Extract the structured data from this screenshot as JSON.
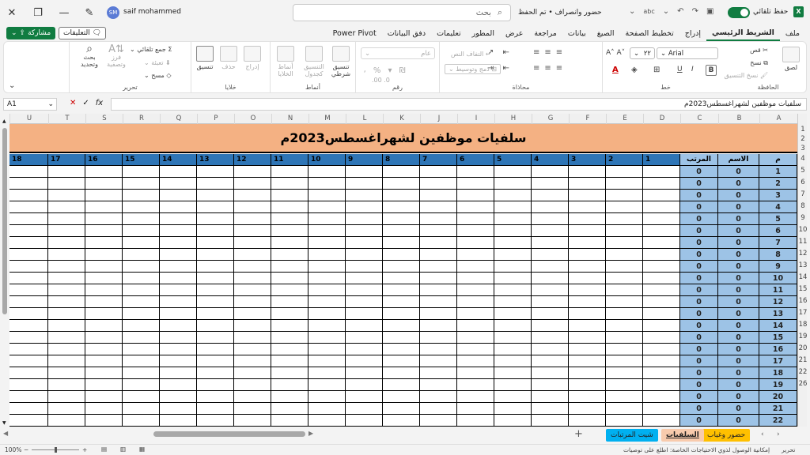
{
  "window": {
    "autosave_label": "حفظ تلقائي",
    "doc_title": "حضور وانصراف • تم الحفظ",
    "search_placeholder": "بحث",
    "user_name": "saif mohammed",
    "user_initials": "SM"
  },
  "tabs": [
    "ملف",
    "الشريط الرئيسي",
    "إدراج",
    "تخطيط الصفحة",
    "الصيغ",
    "بيانات",
    "مراجعة",
    "عرض",
    "المطور",
    "تعليمات",
    "دفق البيانات",
    "Power Pivot"
  ],
  "active_tab": "الشريط الرئيسي",
  "share": {
    "comments_label": "التعليقات",
    "share_label": "مشاركة"
  },
  "ribbon": {
    "clipboard": {
      "label": "الحافظة",
      "paste": "لصق",
      "cut": "قص",
      "copy": "نسخ",
      "format_painter": "نسخ التنسيق"
    },
    "font": {
      "label": "خط",
      "name": "Arial",
      "size": "٢٢",
      "bold": "B",
      "italic": "I",
      "underline": "U"
    },
    "alignment": {
      "label": "محاذاة",
      "wrap": "التفاف النص",
      "merge": "دمج وتوسيط"
    },
    "number": {
      "label": "رقم",
      "format": "عام"
    },
    "styles": {
      "label": "أنماط",
      "conditional": "تنسيق شرطي",
      "table": "التنسيق كجدول",
      "cell_styles": "أنماط الخلايا"
    },
    "cells": {
      "label": "خلايا",
      "insert": "إدراج",
      "delete": "حذف",
      "format": "تنسيق"
    },
    "editing": {
      "label": "تحرير",
      "autosum": "جمع تلقائي",
      "fill": "تعبئة",
      "clear": "مسح",
      "sort": "فرز وتصفية",
      "find": "بحث وتحديد"
    }
  },
  "formula_bar": {
    "name_box": "A1",
    "cancel": "✕",
    "enter": "✓",
    "fx": "fx",
    "content": "سلفيات موظفين  لشهراغسطس2023م"
  },
  "sheet": {
    "columns": [
      "A",
      "B",
      "C",
      "D",
      "E",
      "F",
      "G",
      "H",
      "I",
      "J",
      "K",
      "L",
      "M",
      "N",
      "O",
      "P",
      "Q",
      "R",
      "S",
      "T",
      "U"
    ],
    "title": "سلفيات موظفين  لشهراغسطس2023م",
    "headers": {
      "num": "م",
      "name": "الاسم",
      "salary": "المرتب"
    },
    "day_numbers": [
      "1",
      "2",
      "3",
      "4",
      "5",
      "6",
      "7",
      "8",
      "9",
      "10",
      "11",
      "12",
      "13",
      "14",
      "15",
      "16",
      "17",
      "18"
    ],
    "row_numbers": [
      "1",
      "2",
      "3",
      "4",
      "5",
      "6",
      "7",
      "8",
      "9",
      "10",
      "11",
      "12",
      "13",
      "14",
      "15",
      "16",
      "17",
      "18",
      "19",
      "20",
      "21",
      "22",
      "26"
    ],
    "rows": [
      {
        "n": "1",
        "name": "0",
        "salary": "0"
      },
      {
        "n": "2",
        "name": "0",
        "salary": "0"
      },
      {
        "n": "3",
        "name": "0",
        "salary": "0"
      },
      {
        "n": "4",
        "name": "0",
        "salary": "0"
      },
      {
        "n": "5",
        "name": "0",
        "salary": "0"
      },
      {
        "n": "6",
        "name": "0",
        "salary": "0"
      },
      {
        "n": "7",
        "name": "0",
        "salary": "0"
      },
      {
        "n": "8",
        "name": "0",
        "salary": "0"
      },
      {
        "n": "9",
        "name": "0",
        "salary": "0"
      },
      {
        "n": "10",
        "name": "0",
        "salary": "0"
      },
      {
        "n": "11",
        "name": "0",
        "salary": "0"
      },
      {
        "n": "12",
        "name": "0",
        "salary": "0"
      },
      {
        "n": "13",
        "name": "0",
        "salary": "0"
      },
      {
        "n": "14",
        "name": "0",
        "salary": "0"
      },
      {
        "n": "15",
        "name": "0",
        "salary": "0"
      },
      {
        "n": "16",
        "name": "0",
        "salary": "0"
      },
      {
        "n": "17",
        "name": "0",
        "salary": "0"
      },
      {
        "n": "18",
        "name": "0",
        "salary": "0"
      },
      {
        "n": "19",
        "name": "0",
        "salary": "0"
      },
      {
        "n": "20",
        "name": "0",
        "salary": "0"
      },
      {
        "n": "21",
        "name": "0",
        "salary": "0"
      },
      {
        "n": "22",
        "name": "0",
        "salary": "0"
      }
    ],
    "colors": {
      "banner": "#f4b183",
      "header_dark": "#2e75b6",
      "header_light": "#9dc3e6"
    }
  },
  "sheet_tabs": [
    {
      "label": "حضور وغياب",
      "color": "#ffc000"
    },
    {
      "label": "السلفيات",
      "color": "#f8cbad",
      "active": true
    },
    {
      "label": "شيت المرتبات",
      "color": "#00b0f0"
    }
  ],
  "status": {
    "mode": "تحرير",
    "accessibility": "إمكانية الوصول لذوي الاحتياجات الخاصة: اطلع على توصيات",
    "zoom": "100%"
  }
}
